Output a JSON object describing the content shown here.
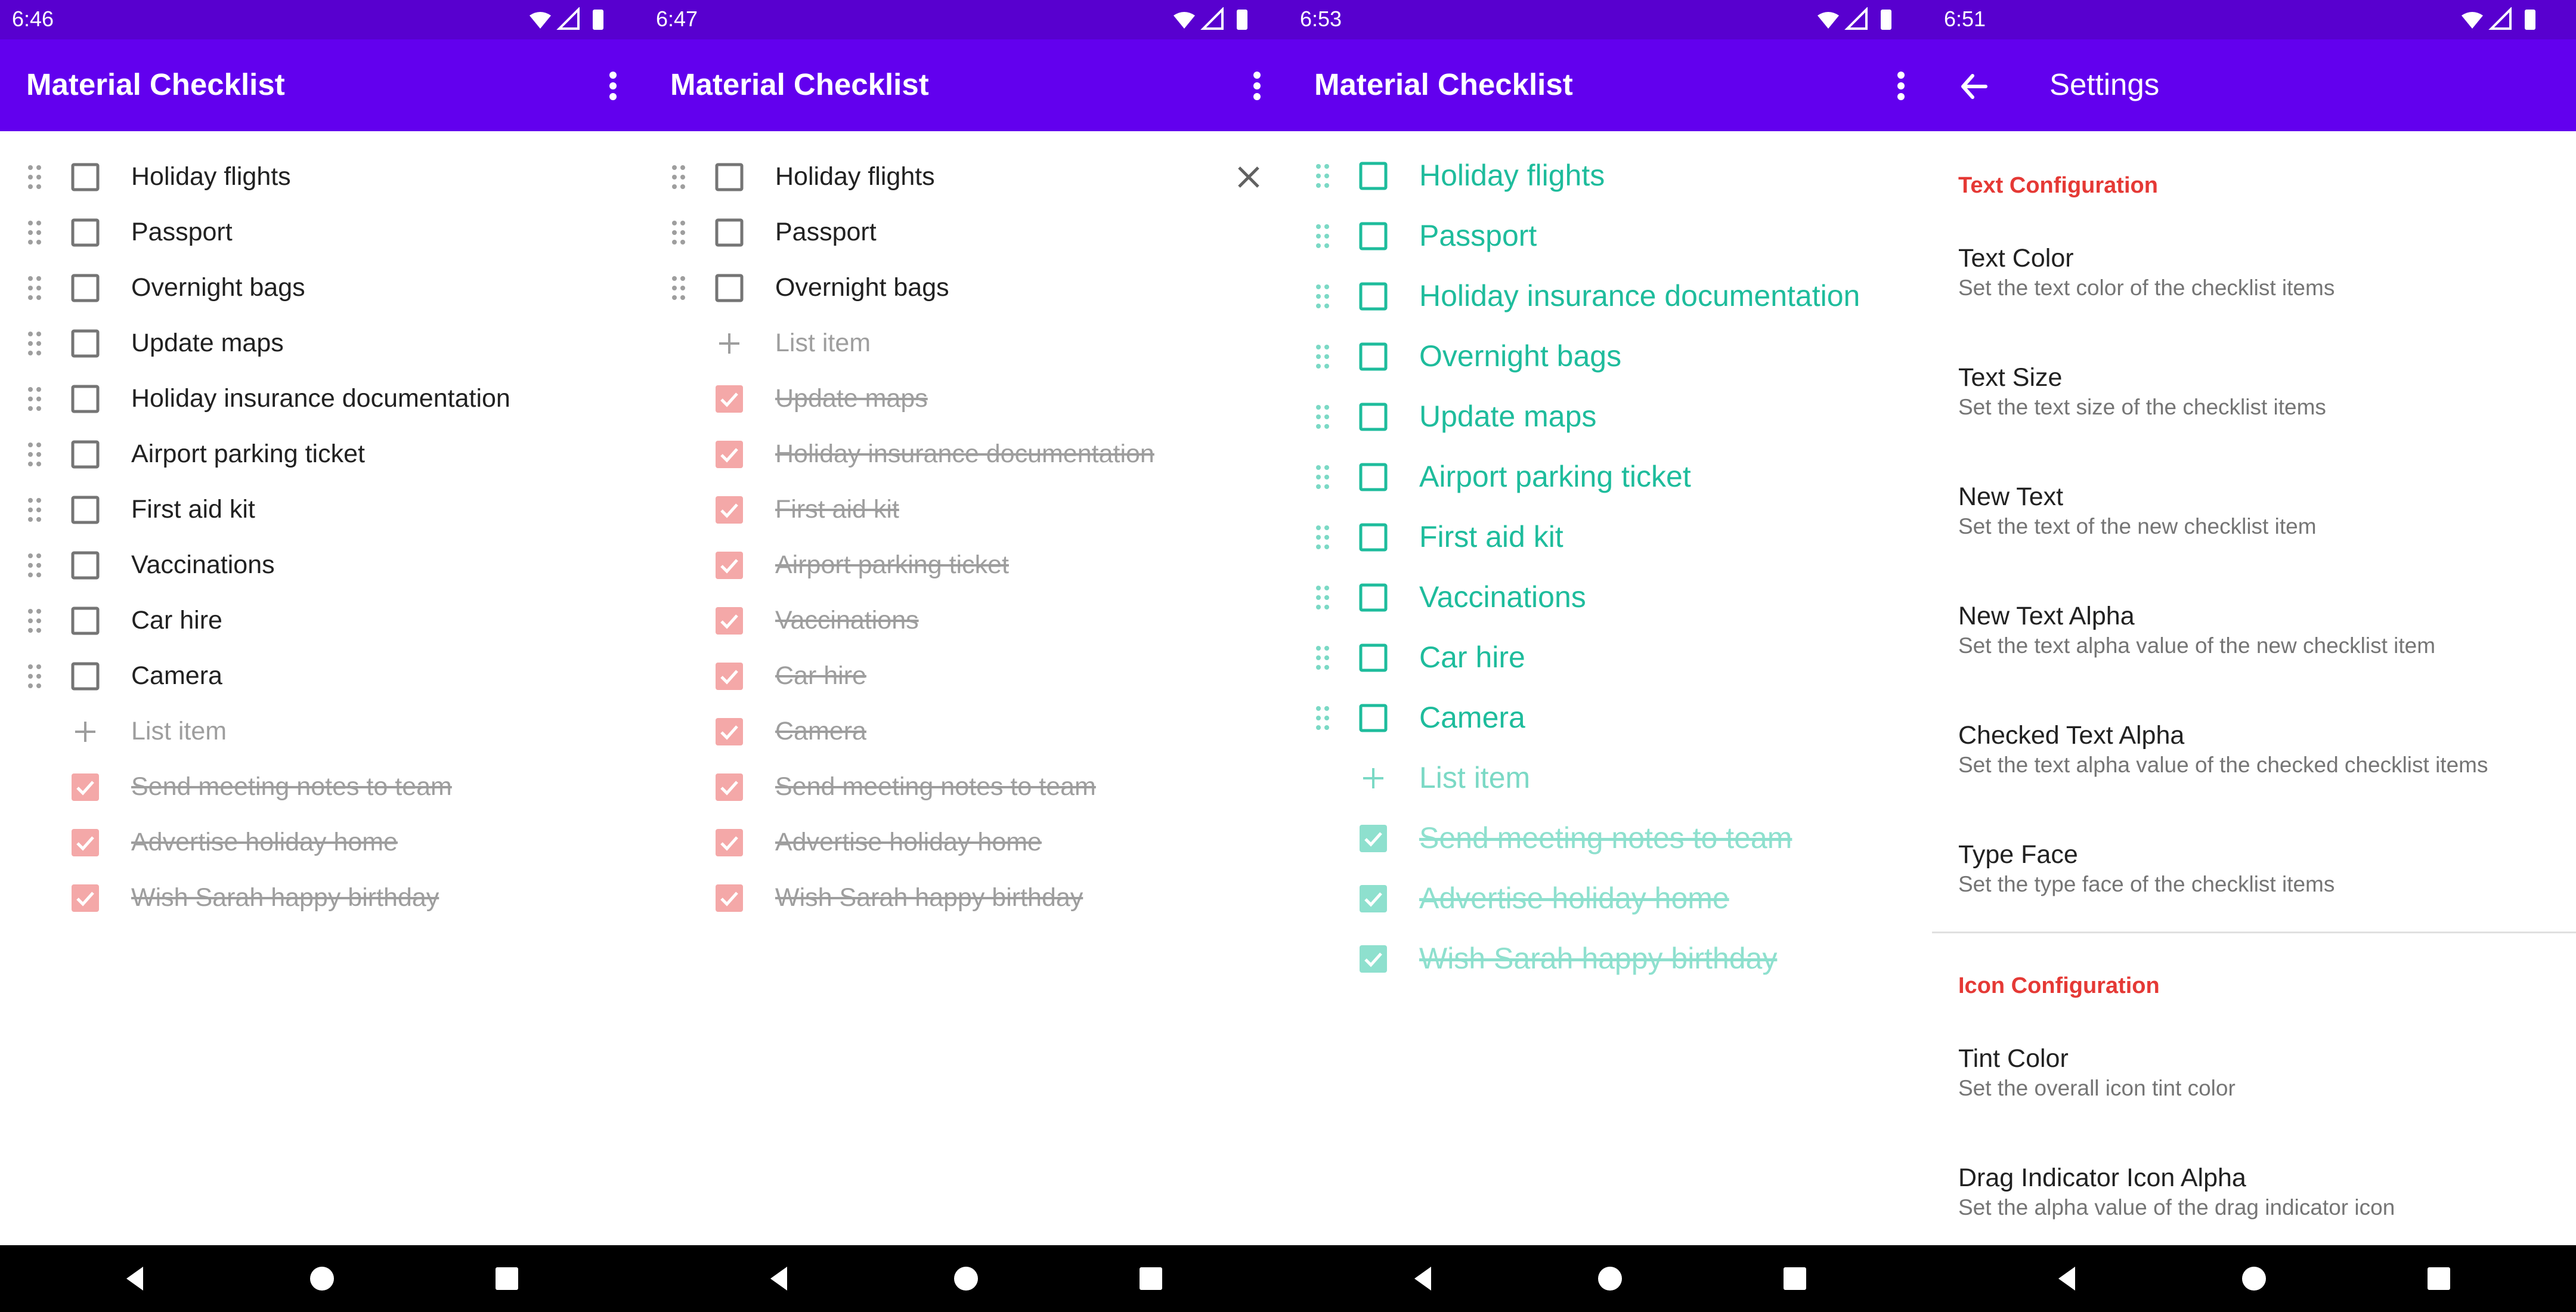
{
  "screens": [
    {
      "time": "6:46",
      "title": "Material Checklist",
      "unchecked": [
        "Holiday flights",
        "Passport",
        "Overnight bags",
        "Update maps",
        "Holiday insurance documentation",
        "Airport parking ticket",
        "First aid kit",
        "Vaccinations",
        "Car hire",
        "Camera"
      ],
      "new_item": "List item",
      "checked": [
        "Send meeting notes to team",
        "Advertise holiday home",
        "Wish Sarah happy birthday"
      ]
    },
    {
      "time": "6:47",
      "title": "Material Checklist",
      "unchecked": [
        "Holiday flights",
        "Passport",
        "Overnight bags"
      ],
      "new_item": "List item",
      "checked": [
        "Update maps",
        "Holiday insurance documentation",
        "First aid kit",
        "Airport parking ticket",
        "Vaccinations",
        "Car hire",
        "Camera",
        "Send meeting notes to team",
        "Advertise holiday home",
        "Wish Sarah happy birthday"
      ]
    },
    {
      "time": "6:53",
      "title": "Material Checklist",
      "unchecked": [
        "Holiday flights",
        "Passport",
        "Holiday insurance documentation",
        "Overnight bags",
        "Update maps",
        "Airport parking ticket",
        "First aid kit",
        "Vaccinations",
        "Car hire",
        "Camera"
      ],
      "new_item": "List item",
      "checked": [
        "Send meeting notes to team",
        "Advertise holiday home",
        "Wish Sarah happy birthday"
      ]
    }
  ],
  "settings": {
    "time": "6:51",
    "title": "Settings",
    "text_section": "Text Configuration",
    "text_items": [
      {
        "title": "Text Color",
        "summary": "Set the text color of the checklist items"
      },
      {
        "title": "Text Size",
        "summary": "Set the text size of the checklist items"
      },
      {
        "title": "New Text",
        "summary": "Set the text of the new checklist item"
      },
      {
        "title": "New Text Alpha",
        "summary": "Set the text alpha value of the new checklist item"
      },
      {
        "title": "Checked Text Alpha",
        "summary": "Set the text alpha value of the checked checklist items"
      },
      {
        "title": "Type Face",
        "summary": "Set the type face of the checklist items"
      }
    ],
    "icon_section": "Icon Configuration",
    "icon_items": [
      {
        "title": "Tint Color",
        "summary": "Set the overall icon tint color"
      },
      {
        "title": "Drag Indicator Icon Alpha",
        "summary": "Set the alpha value of the drag indicator icon"
      }
    ]
  },
  "colors": {
    "status_bar": "#5800cf",
    "app_bar": "#6200ee",
    "checked_tint": "#f4a8a8",
    "teal": "#1ebc9c",
    "section_header": "#e53935"
  },
  "icons": {
    "drag": "drag-handle-icon",
    "checkbox": "checkbox-icon",
    "add": "add-icon",
    "delete": "close-icon",
    "overflow": "more-vert-icon",
    "back": "arrow-back-icon"
  }
}
